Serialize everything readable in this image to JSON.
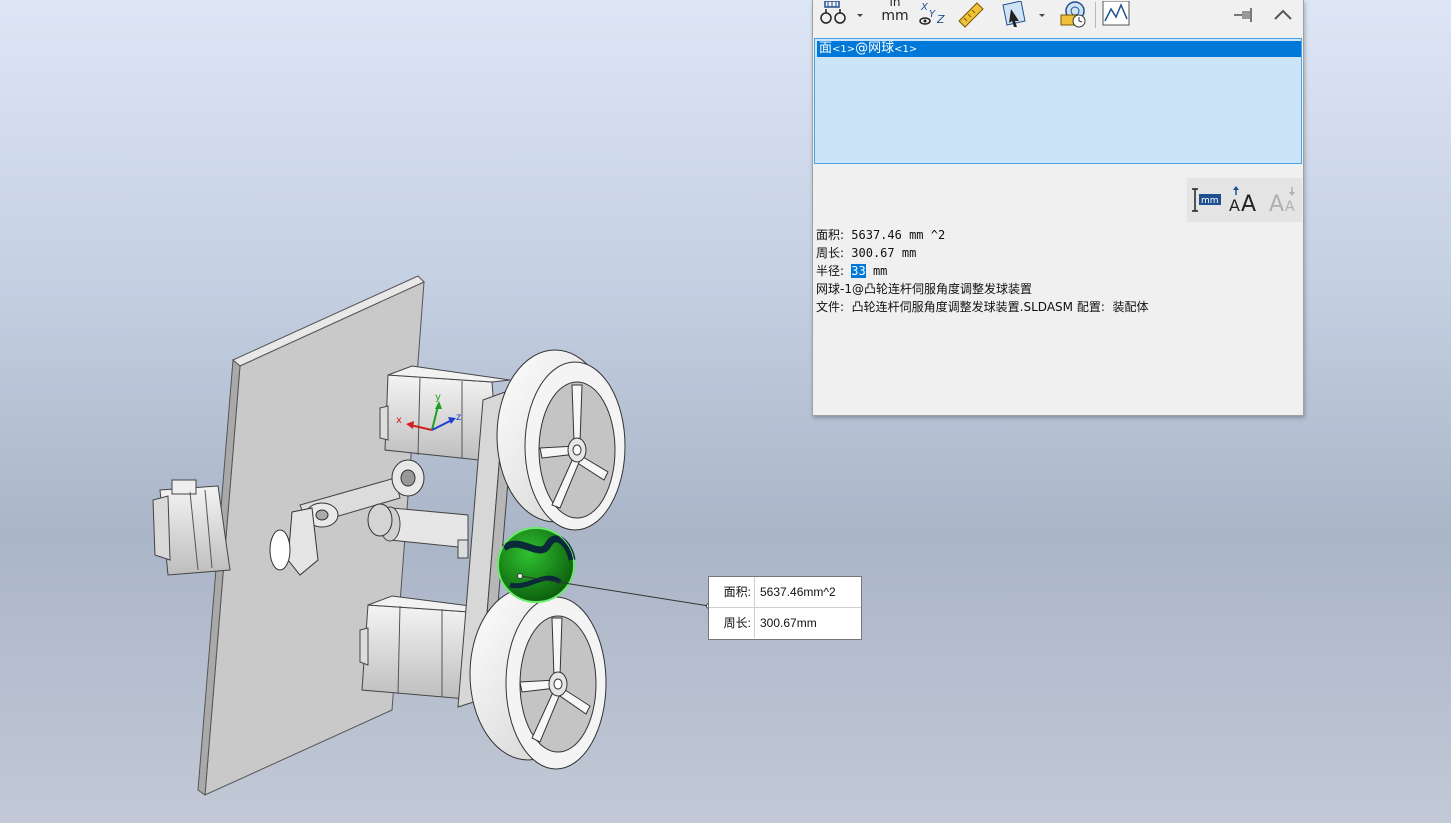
{
  "toolbar": {
    "units_top": "in",
    "units_bottom": "mm",
    "buttons": [
      "arc-circle-measurements-icon",
      "units-precision-icon",
      "show-xyz-icon",
      "point-to-point-icon",
      "projection-icon",
      "history-icon",
      "sensor-icon",
      "pin-icon",
      "collapse-icon"
    ]
  },
  "selection": {
    "item_main_1": "面",
    "item_sub_1": "<1>",
    "item_main_2": "@网球",
    "item_sub_2": "<1>"
  },
  "results": {
    "area_label": "面积:",
    "area_value": " 5637.46 mm ^2",
    "perimeter_label": "周长:",
    "perimeter_value": " 300.67 mm",
    "radius_label": "半径:",
    "radius_value": "33",
    "radius_unit": " mm",
    "component_line": "网球-1@凸轮连杆伺服角度调整发球装置",
    "file_label": "文件:",
    "file_value": "  凸轮连杆伺服角度调整发球装置.SLDASM 配置:  装配体"
  },
  "callout": {
    "area_label": "面积:",
    "area_value": "5637.46mm^2",
    "perimeter_label": "周长:",
    "perimeter_value": "300.67mm"
  },
  "triad": {
    "x": "x",
    "y": "y",
    "z": "z"
  },
  "colors": {
    "selection_blue": "#0078d7",
    "list_bg": "#cce4f7",
    "ball_green": "#1f9a1f",
    "triad_x": "#d02020",
    "triad_y": "#1ea01e",
    "triad_z": "#1f3fd0"
  }
}
